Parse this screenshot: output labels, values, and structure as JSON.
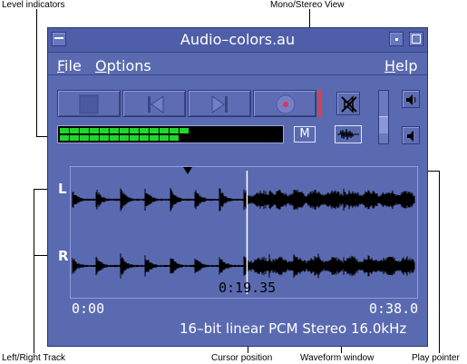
{
  "window": {
    "title": "Audio–colors.au",
    "menus": [
      {
        "label": "File",
        "mnemonic": "F",
        "rest": "ile"
      },
      {
        "label": "Options",
        "mnemonic": "O",
        "rest": "ptions"
      },
      {
        "label": "Help",
        "mnemonic": "H",
        "rest": "elp"
      }
    ]
  },
  "transport": {
    "buttons": [
      "stop",
      "previous",
      "next",
      "record"
    ]
  },
  "level": {
    "lit_segments": 14,
    "total_segments": 14,
    "color": "#1ed82a"
  },
  "view": {
    "mono_stereo_label": "M"
  },
  "volume": {
    "level": 0.3
  },
  "waveform": {
    "left_track_label": "L",
    "right_track_label": "R",
    "start_time": "0:00",
    "end_time": "0:38.0",
    "cursor_time": "0:19.35",
    "cursor_fraction": 0.509,
    "play_pointer_fraction": 0.34,
    "format": "16–bit linear PCM Stereo 16.0kHz"
  },
  "callouts": {
    "level_indicators": "Level indicators",
    "mono_stereo_view": "Mono/Stereo View",
    "left_right_track": "Left/Right Track",
    "cursor_position": "Cursor position",
    "waveform_window": "Waveform window",
    "play_pointer": "Play pointer"
  },
  "colors": {
    "window_bg": "#5a6ab0",
    "waveform": "#000000",
    "level_on": "#1ed82a"
  }
}
